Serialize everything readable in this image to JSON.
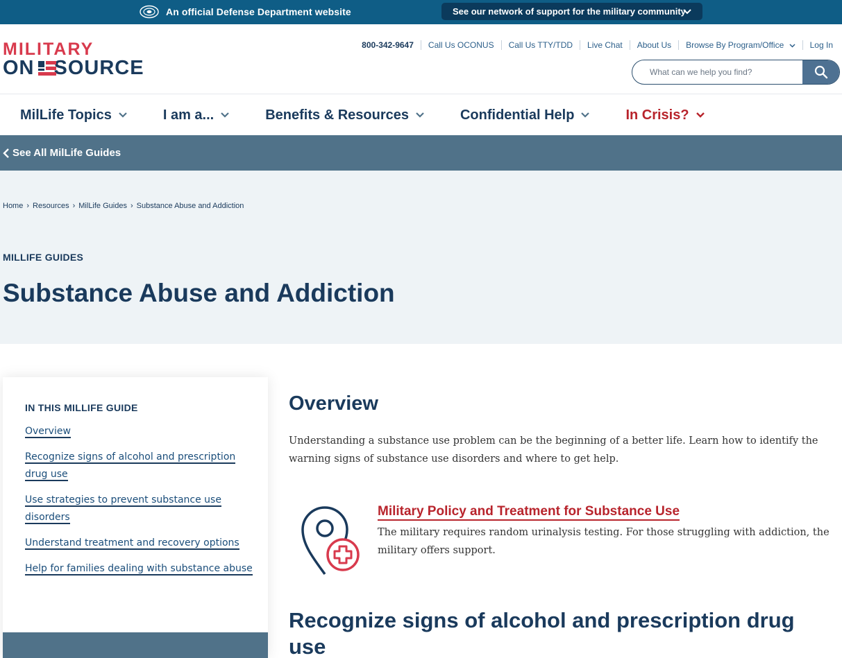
{
  "banner": {
    "official": "An official Defense Department website",
    "network": "See our network of support for the military community"
  },
  "logo": {
    "line1": "MILITARY",
    "line2_prefix": "ON",
    "line2_suffix": "SOURCE"
  },
  "utility": {
    "phone": "800-342-9647",
    "oconus": "Call Us OCONUS",
    "tty": "Call Us TTY/TDD",
    "chat": "Live Chat",
    "about": "About Us",
    "browse": "Browse By Program/Office",
    "login": "Log In"
  },
  "search": {
    "placeholder": "What can we help you find?"
  },
  "nav": {
    "topics": "MilLife Topics",
    "iama": "I am a...",
    "benefits": "Benefits & Resources",
    "confidential": "Confidential Help",
    "crisis": "In Crisis?"
  },
  "back": {
    "label": "See All MilLife Guides"
  },
  "breadcrumb": {
    "home": "Home",
    "resources": "Resources",
    "guides": "MilLife Guides",
    "current": "Substance Abuse and Addiction"
  },
  "hero": {
    "eyebrow": "MILLIFE GUIDES",
    "title": "Substance Abuse and Addiction"
  },
  "toc": {
    "heading": "IN THIS MILLIFE GUIDE",
    "items": [
      {
        "label": "Overview"
      },
      {
        "label": "Recognize signs of alcohol and prescription drug use"
      },
      {
        "label": "Use strategies to prevent substance use disorders"
      },
      {
        "label": "Understand treatment and recovery options"
      },
      {
        "label": "Help for families dealing with substance abuse"
      }
    ]
  },
  "content": {
    "overview_title": "Overview",
    "overview_text": "Understanding a substance use problem can be the beginning of a better life. Learn how to identify the warning signs of substance use disorders and where to get help.",
    "card_title": "Military Policy and Treatment for Substance Use",
    "card_desc": "The military requires random urinalysis testing. For those struggling with addiction, the military offers support.",
    "section2_title": "Recognize signs of alcohol and prescription drug use"
  },
  "colors": {
    "banner": "#0f5d86",
    "navy": "#1a3a5c",
    "crimson": "#b8242c",
    "slate": "#507289",
    "hero_bg": "#eef3f6"
  }
}
